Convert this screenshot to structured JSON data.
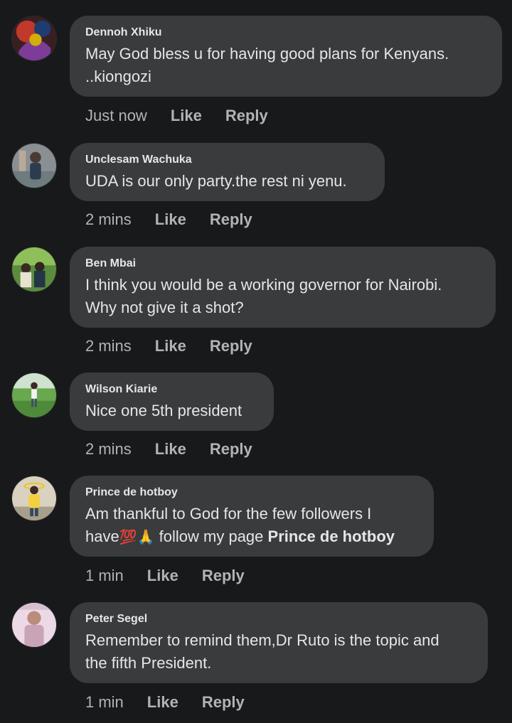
{
  "colors": {
    "background": "#18191a",
    "bubble": "#3a3b3c",
    "primary_text": "#e4e6eb",
    "secondary_text": "#b0b3b8"
  },
  "comments": [
    {
      "author": "Dennoh Xhiku",
      "avatar_icon": "profile-photo-icon",
      "text_lines": [
        "May God bless  u for having  good plans for Kenyans.",
        "..kiongozi"
      ],
      "time": "Just now",
      "like_label": "Like",
      "reply_label": "Reply"
    },
    {
      "author": "Unclesam Wachuka",
      "avatar_icon": "profile-photo-icon",
      "text_lines": [
        "UDA is our only party.the rest ni yenu."
      ],
      "time": "2 mins",
      "like_label": "Like",
      "reply_label": "Reply"
    },
    {
      "author": "Ben Mbai",
      "avatar_icon": "profile-photo-icon",
      "text_lines": [
        "I think you would be a working governor for Nairobi.",
        "Why not give it a shot?"
      ],
      "time": "2 mins",
      "like_label": "Like",
      "reply_label": "Reply"
    },
    {
      "author": "Wilson Kiarie",
      "avatar_icon": "profile-photo-icon",
      "text_lines": [
        "Nice one 5th president"
      ],
      "time": "2 mins",
      "like_label": "Like",
      "reply_label": "Reply"
    },
    {
      "author": "Prince de hotboy",
      "avatar_icon": "profile-photo-icon",
      "text_line1": "Am thankful to God for the few followers I",
      "text_line2_pre": "have",
      "emoji_1": "💯",
      "emoji_2": "🙏",
      "text_line2_mid": "follow my page ",
      "text_line2_bold": "Prince de hotboy",
      "time": "1 min",
      "like_label": "Like",
      "reply_label": "Reply"
    },
    {
      "author": "Peter Segel",
      "avatar_icon": "profile-photo-icon",
      "text_lines": [
        "Remember to remind them,Dr Ruto is the topic and",
        "the fifth President."
      ],
      "time": "1 min",
      "like_label": "Like",
      "reply_label": "Reply"
    }
  ]
}
